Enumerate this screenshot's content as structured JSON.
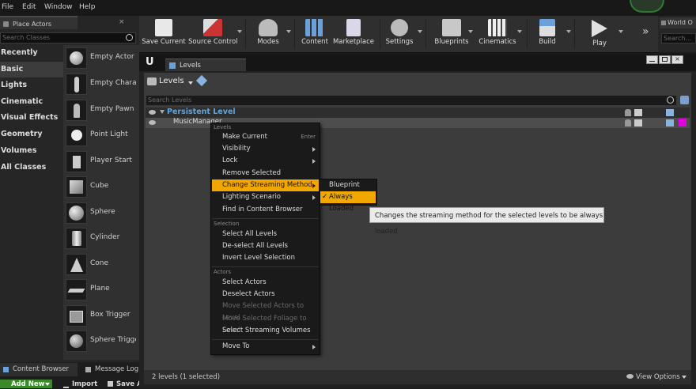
{
  "menubar": {
    "items": [
      "File",
      "Edit",
      "Window",
      "Help"
    ]
  },
  "place_actors": {
    "tab_label": "Place Actors",
    "search_placeholder": "Search Classes",
    "categories": [
      "Recently Placed",
      "Basic",
      "Lights",
      "Cinematic",
      "Visual Effects",
      "Geometry",
      "Volumes",
      "All Classes"
    ],
    "selected_category": "Basic",
    "actors": [
      "Empty Actor",
      "Empty Character",
      "Empty Pawn",
      "Point Light",
      "Player Start",
      "Cube",
      "Sphere",
      "Cylinder",
      "Cone",
      "Plane",
      "Box Trigger",
      "Sphere Trigger"
    ]
  },
  "toolbar": {
    "buttons": [
      "Save Current",
      "Source Control",
      "Modes",
      "Content",
      "Marketplace",
      "Settings",
      "Blueprints",
      "Cinematics",
      "Build",
      "Play"
    ],
    "overflow": "»"
  },
  "world_panel": {
    "tab_label": "World O",
    "search_placeholder": "Search..."
  },
  "levels": {
    "tab_label": "Levels",
    "dropdown_label": "Levels",
    "search_placeholder": "Search Levels",
    "persistent_level": "Persistent Level",
    "sublevel": "MusicManager",
    "status": "2 levels (1 selected)",
    "view_options": "View Options"
  },
  "context_menu": {
    "sections": [
      {
        "header": "Levels",
        "items": [
          {
            "label": "Make Current",
            "shortcut": "Enter"
          },
          {
            "label": "Visibility",
            "submenu": true
          },
          {
            "label": "Lock",
            "submenu": true
          },
          {
            "label": "Remove Selected"
          },
          {
            "label": "Change Streaming Method",
            "submenu": true,
            "highlighted": true
          },
          {
            "label": "Lighting Scenario",
            "submenu": true
          },
          {
            "label": "Find in Content Browser"
          }
        ]
      },
      {
        "header": "Selection",
        "items": [
          {
            "label": "Select All Levels"
          },
          {
            "label": "De-select All Levels"
          },
          {
            "label": "Invert Level Selection"
          }
        ]
      },
      {
        "header": "Actors",
        "items": [
          {
            "label": "Select Actors"
          },
          {
            "label": "Deselect Actors"
          },
          {
            "label": "Move Selected Actors to Level",
            "disabled": true
          },
          {
            "label": "Move Selected Foliage to Level",
            "disabled": true
          },
          {
            "label": "Select Streaming Volumes"
          }
        ]
      },
      {
        "header": "",
        "items": [
          {
            "label": "Move To",
            "submenu": true
          }
        ]
      }
    ]
  },
  "streaming_submenu": {
    "items": [
      {
        "label": "Blueprint"
      },
      {
        "label": "Always Loaded",
        "checked": true,
        "check": "✓"
      }
    ]
  },
  "tooltip": "Changes the streaming method for the selected levels to be always loaded",
  "bottom": {
    "tabs": [
      "Content Browser",
      "Message Log"
    ],
    "add_new": "Add New",
    "import": "Import",
    "save_all": "Save All"
  },
  "colors": {
    "accent": "#f0a700",
    "persistent_level_text": "#5aa6e6",
    "level_color_swatch": "#e000e0",
    "add_new_green": "#3b8a2a"
  }
}
